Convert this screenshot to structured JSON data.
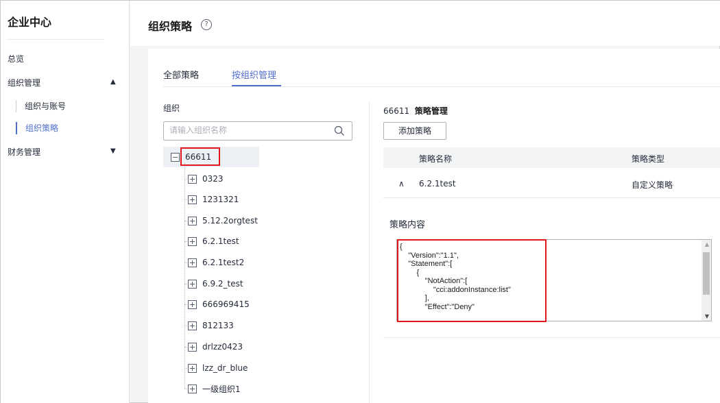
{
  "sidebar": {
    "title": "企业中心",
    "items": [
      {
        "label": "总览"
      },
      {
        "label": "组织管理",
        "arrow": "▲"
      },
      {
        "label": "组织与账号"
      },
      {
        "label": "组织策略"
      },
      {
        "label": "财务管理",
        "arrow": "▼"
      }
    ]
  },
  "header": {
    "title": "组织策略",
    "help_symbol": "?"
  },
  "tabs": [
    {
      "label": "全部策略",
      "active": false
    },
    {
      "label": "按组织管理",
      "active": true
    }
  ],
  "org": {
    "label": "组织",
    "search_placeholder": "请输入组织名称",
    "root": "66611",
    "children": [
      "0323",
      "1231321",
      "5.12.2orgtest",
      "6.2.1test",
      "6.2.1test2",
      "6.9.2_test",
      "666969415",
      "812133",
      "drlzz0423",
      "lzz_dr_blue",
      "一级组织1"
    ]
  },
  "policy_mgmt": {
    "org_id": "66611",
    "title": "策略管理",
    "add_button": "添加策略",
    "columns": [
      "策略名称",
      "策略类型"
    ],
    "rows": [
      {
        "name": "6.2.1test",
        "type": "自定义策略",
        "expanded": true,
        "toggle": "∧"
      }
    ],
    "content_label": "策略内容",
    "content_code": "{\n    \"Version\":\"1.1\",\n    \"Statement\":[\n        {\n            \"NotAction\":[\n                \"cci:addonInstance:list\"\n            ],\n            \"Effect\":\"Deny\""
  },
  "colors": {
    "accent": "#526ecc",
    "highlight_red": "#e0181c",
    "text": "#252b3a"
  }
}
